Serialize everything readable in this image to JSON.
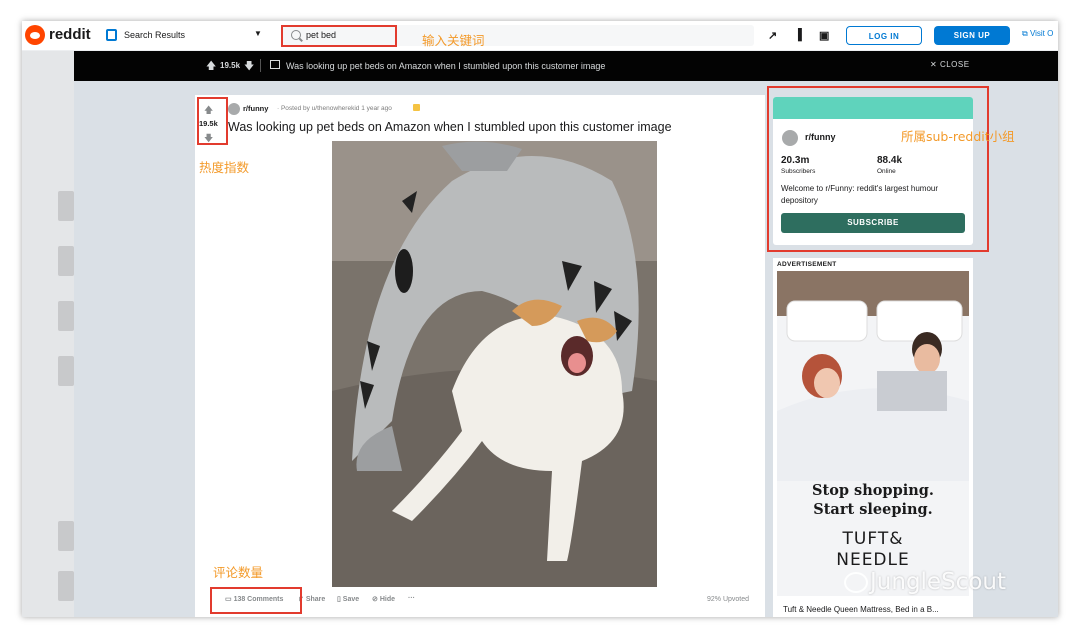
{
  "header": {
    "logo_text": "reddit",
    "location_label": "Search Results",
    "search_value": "pet bed",
    "login_label": "LOG IN",
    "signup_label": "SIGN UP",
    "visit_label": "Visit O"
  },
  "post_bar": {
    "score": "19.5k",
    "title": "Was looking up pet beds on Amazon when I stumbled upon this customer image",
    "close_label": "CLOSE"
  },
  "post": {
    "score": "19.5k",
    "subreddit": "r/funny",
    "posted_by": "· Posted by u/thenowherekid 1 year ago",
    "title": "Was looking up pet beds on Amazon when I stumbled upon this customer image",
    "comments_label": "138 Comments",
    "share_label": "Share",
    "save_label": "Save",
    "hide_label": "Hide",
    "more_label": "···",
    "upvoted_label": "92% Upvoted"
  },
  "community": {
    "name": "r/funny",
    "subscribers_value": "20.3m",
    "subscribers_label": "Subscribers",
    "online_value": "88.4k",
    "online_label": "Online",
    "description": "Welcome to r/Funny: reddit's largest humour depository",
    "subscribe_label": "SUBSCRIBE"
  },
  "ad": {
    "label": "ADVERTISEMENT",
    "headline_1": "Stop shopping.",
    "headline_2": "Start sleeping.",
    "brand_1": "TUFT&",
    "brand_2": "NEEDLE",
    "caption": "Tuft & Needle Queen Mattress, Bed in a B..."
  },
  "annotations": {
    "search": "输入关键词",
    "score": "热度指数",
    "subreddit": "所属sub-reddit小组",
    "comments": "评论数量"
  },
  "watermark": "JungleScout",
  "colors": {
    "accent": "#0079d3",
    "reddit_orange": "#ff4500",
    "annotation_red": "#e23b2e",
    "annotation_orange": "#f39a2a",
    "community_band": "#5fd3bc",
    "subscribe_button": "#2e6e5f"
  }
}
